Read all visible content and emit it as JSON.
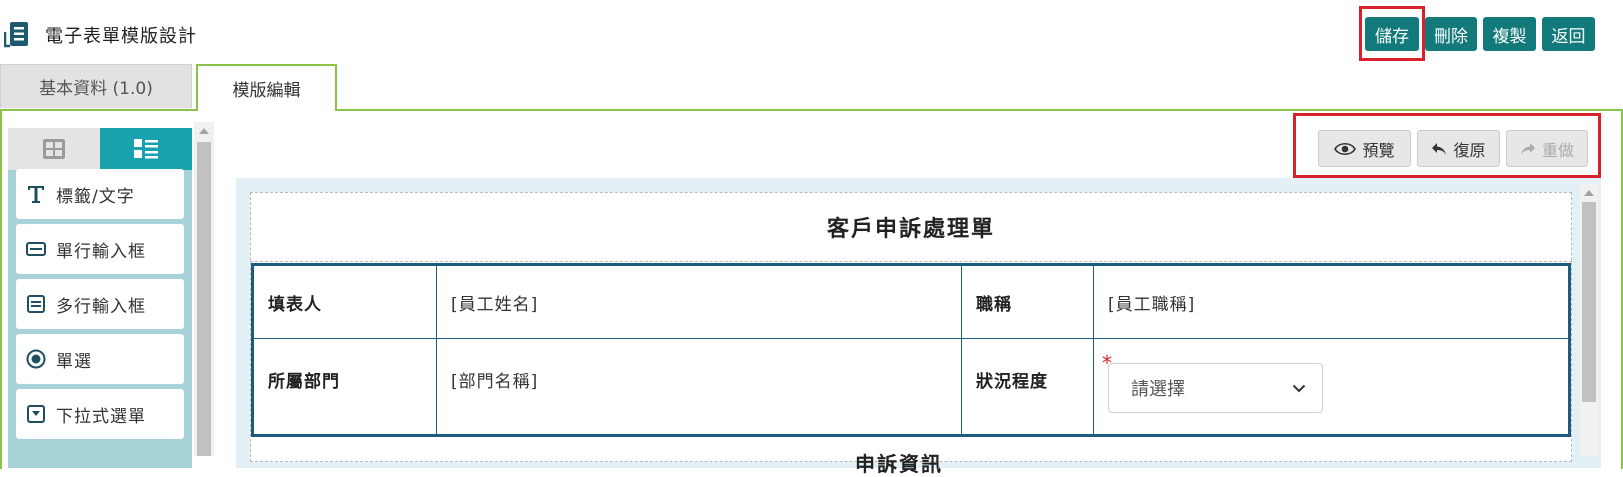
{
  "header": {
    "title": "電子表單模版設計",
    "buttons": {
      "save": "儲存",
      "delete": "刪除",
      "copy": "複製",
      "back": "返回"
    }
  },
  "tabs": [
    {
      "label": "基本資料 (1.0)",
      "active": false
    },
    {
      "label": "模版編輯",
      "active": true
    }
  ],
  "sidebar": {
    "view_tabs": [
      {
        "icon": "grid-icon",
        "active": false
      },
      {
        "icon": "list-icon",
        "active": true
      }
    ],
    "items": [
      {
        "label": "標籤/文字",
        "icon": "text-icon"
      },
      {
        "label": "單行輸入框",
        "icon": "single-line-input-icon"
      },
      {
        "label": "多行輸入框",
        "icon": "multi-line-input-icon"
      },
      {
        "label": "單選",
        "icon": "radio-icon"
      },
      {
        "label": "下拉式選單",
        "icon": "dropdown-icon"
      }
    ]
  },
  "toolbar": {
    "preview": "預覽",
    "undo": "復原",
    "redo": "重做"
  },
  "form": {
    "title": "客戶申訴處理單",
    "rows": [
      {
        "label1": "填表人",
        "value1": "[員工姓名]",
        "label2": "職稱",
        "value2": "[員工職稱]"
      },
      {
        "label1": "所屬部門",
        "value1": "[部門名稱]",
        "label2": "狀況程度",
        "select_value": "請選擇",
        "required": "*"
      }
    ],
    "next_section_title": "申訴資訊"
  },
  "colors": {
    "primary_button": "#137a7c",
    "highlight": "#d9212c",
    "tab_border": "#8bc34a",
    "sidebar_bg": "#a7d2d8",
    "sidebar_active": "#17a2ad",
    "table_border": "#1c5c7f"
  }
}
